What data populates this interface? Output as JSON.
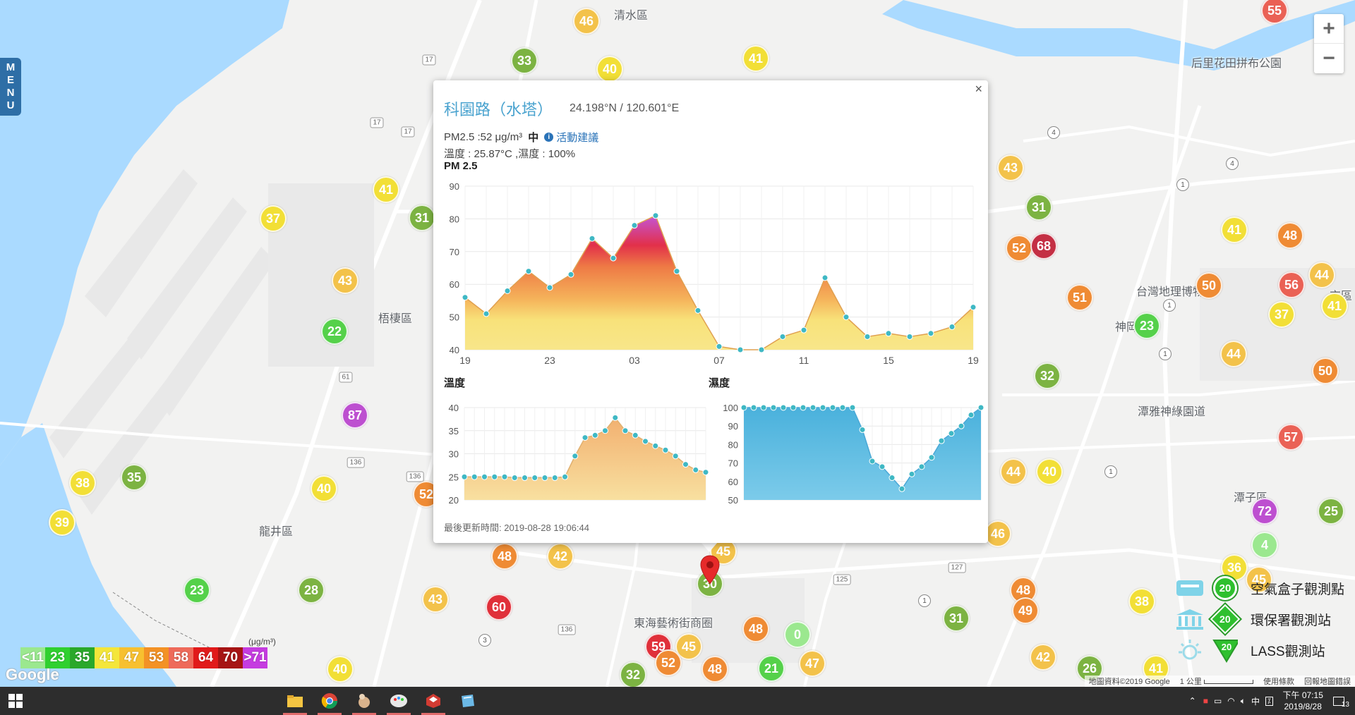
{
  "menu": {
    "label": "MENU"
  },
  "zoom": {
    "in_label": "+",
    "out_label": "−"
  },
  "map_labels": [
    {
      "text": "清水區",
      "x": 870,
      "y": 8
    },
    {
      "text": "后里花田拼布公園",
      "x": 1688,
      "y": 76
    },
    {
      "text": "梧棲區",
      "x": 536,
      "y": 438
    },
    {
      "text": "台灣地理博物館",
      "x": 1610,
      "y": 400
    },
    {
      "text": "神岡區",
      "x": 1580,
      "y": 450
    },
    {
      "text": "潭雅神綠園道",
      "x": 1612,
      "y": 570
    },
    {
      "text": "龍井區",
      "x": 367,
      "y": 740
    },
    {
      "text": "潭子區",
      "x": 1748,
      "y": 692
    },
    {
      "text": "東海藝術街商圈",
      "x": 898,
      "y": 870
    },
    {
      "text": "京區",
      "x": 1884,
      "y": 406
    }
  ],
  "markers": [
    {
      "v": "46",
      "x": 831,
      "y": 30
    },
    {
      "v": "33",
      "x": 743,
      "y": 86
    },
    {
      "v": "40",
      "x": 864,
      "y": 98
    },
    {
      "v": "41",
      "x": 1071,
      "y": 83
    },
    {
      "v": "55",
      "x": 1806,
      "y": 15
    },
    {
      "v": "41",
      "x": 547,
      "y": 269
    },
    {
      "v": "37",
      "x": 387,
      "y": 310
    },
    {
      "v": "31",
      "x": 598,
      "y": 309
    },
    {
      "v": "43",
      "x": 489,
      "y": 398
    },
    {
      "v": "22",
      "x": 474,
      "y": 470
    },
    {
      "v": "87",
      "x": 503,
      "y": 589
    },
    {
      "v": "38",
      "x": 117,
      "y": 685
    },
    {
      "v": "35",
      "x": 190,
      "y": 677
    },
    {
      "v": "39",
      "x": 88,
      "y": 741
    },
    {
      "v": "40",
      "x": 459,
      "y": 693
    },
    {
      "v": "52",
      "x": 604,
      "y": 701
    },
    {
      "v": "48",
      "x": 715,
      "y": 789
    },
    {
      "v": "42",
      "x": 794,
      "y": 789
    },
    {
      "v": "23",
      "x": 279,
      "y": 837
    },
    {
      "v": "28",
      "x": 441,
      "y": 837
    },
    {
      "v": "43",
      "x": 617,
      "y": 850
    },
    {
      "v": "60",
      "x": 707,
      "y": 861
    },
    {
      "v": "40",
      "x": 482,
      "y": 949
    },
    {
      "v": "59",
      "x": 933,
      "y": 917
    },
    {
      "v": "45",
      "x": 976,
      "y": 917
    },
    {
      "v": "52",
      "x": 947,
      "y": 940
    },
    {
      "v": "48",
      "x": 1013,
      "y": 949
    },
    {
      "v": "32",
      "x": 897,
      "y": 957
    },
    {
      "v": "48",
      "x": 1071,
      "y": 892
    },
    {
      "v": "0",
      "x": 1130,
      "y": 900
    },
    {
      "v": "21",
      "x": 1093,
      "y": 948
    },
    {
      "v": "47",
      "x": 1151,
      "y": 941
    },
    {
      "v": "30",
      "x": 1006,
      "y": 828
    },
    {
      "v": "45",
      "x": 1025,
      "y": 782
    },
    {
      "v": "43",
      "x": 1432,
      "y": 238
    },
    {
      "v": "31",
      "x": 1472,
      "y": 294
    },
    {
      "v": "52",
      "x": 1444,
      "y": 352
    },
    {
      "v": "68",
      "x": 1479,
      "y": 349
    },
    {
      "v": "51",
      "x": 1530,
      "y": 422
    },
    {
      "v": "23",
      "x": 1625,
      "y": 462
    },
    {
      "v": "32",
      "x": 1484,
      "y": 533
    },
    {
      "v": "41",
      "x": 1749,
      "y": 326
    },
    {
      "v": "48",
      "x": 1828,
      "y": 334
    },
    {
      "v": "50",
      "x": 1713,
      "y": 405
    },
    {
      "v": "56",
      "x": 1830,
      "y": 404
    },
    {
      "v": "44",
      "x": 1873,
      "y": 390
    },
    {
      "v": "41",
      "x": 1891,
      "y": 434
    },
    {
      "v": "37",
      "x": 1816,
      "y": 446
    },
    {
      "v": "44",
      "x": 1748,
      "y": 502
    },
    {
      "v": "50",
      "x": 1878,
      "y": 526
    },
    {
      "v": "44",
      "x": 1436,
      "y": 669
    },
    {
      "v": "40",
      "x": 1487,
      "y": 669
    },
    {
      "v": "46",
      "x": 1414,
      "y": 757
    },
    {
      "v": "57",
      "x": 1829,
      "y": 620
    },
    {
      "v": "72",
      "x": 1792,
      "y": 725
    },
    {
      "v": "25",
      "x": 1886,
      "y": 725
    },
    {
      "v": "4",
      "x": 1792,
      "y": 773
    },
    {
      "v": "36",
      "x": 1749,
      "y": 805
    },
    {
      "v": "45",
      "x": 1784,
      "y": 822
    },
    {
      "v": "48",
      "x": 1450,
      "y": 837
    },
    {
      "v": "49",
      "x": 1453,
      "y": 866
    },
    {
      "v": "38",
      "x": 1618,
      "y": 853
    },
    {
      "v": "31",
      "x": 1355,
      "y": 877
    },
    {
      "v": "42",
      "x": 1478,
      "y": 932
    },
    {
      "v": "26",
      "x": 1544,
      "y": 948
    },
    {
      "v": "41",
      "x": 1638,
      "y": 948
    }
  ],
  "legend": {
    "cells": [
      {
        "label": "<11",
        "color": "#9be88f"
      },
      {
        "label": "23",
        "color": "#2fd02f"
      },
      {
        "label": "35",
        "color": "#2aa82a"
      },
      {
        "label": "41",
        "color": "#f4e63a"
      },
      {
        "label": "47",
        "color": "#f7c030"
      },
      {
        "label": "53",
        "color": "#f39225"
      },
      {
        "label": "58",
        "color": "#ee6a5a"
      },
      {
        "label": "64",
        "color": "#e11a1a"
      },
      {
        "label": "70",
        "color": "#a61414"
      },
      {
        "label": ">71",
        "color": "#c53ce0"
      }
    ],
    "unit": "(μg/m³)"
  },
  "google_logo": "Google",
  "attribution": {
    "data": "地圖資料©2019 Google",
    "scale": "1 公里",
    "terms": "使用條款",
    "report": "回報地圖錯誤"
  },
  "station_legend": [
    {
      "value": "20",
      "label": "空氣盒子觀測點"
    },
    {
      "value": "20",
      "label": "環保署觀測站"
    },
    {
      "value": "20",
      "label": "LASS觀測站"
    }
  ],
  "popup": {
    "close": "×",
    "title": "科園路（水塔）",
    "coords": "24.198°N / 120.601°E",
    "pm_text": "PM2.5 :52 μg/m³",
    "pm_level": "中",
    "advice_icon": "i",
    "advice_label": "活動建議",
    "env_text": "溫度 : 25.87°C ,濕度 : 100%",
    "pm_chart_title": "PM 2.5",
    "temp_chart_title": "溫度",
    "humid_chart_title": "濕度",
    "updated": "最後更新時間: 2019-08-28 19:06:44"
  },
  "chart_data": [
    {
      "type": "area",
      "title": "PM 2.5",
      "x_tick_labels": [
        "19",
        "23",
        "03",
        "07",
        "11",
        "15",
        "19"
      ],
      "ylim": [
        40,
        90
      ],
      "y_ticks": [
        40,
        50,
        60,
        70,
        80,
        90
      ],
      "grid": true,
      "values": [
        56,
        51,
        58,
        64,
        59,
        63,
        74,
        68,
        78,
        81,
        64,
        52,
        41,
        40,
        40,
        44,
        46,
        62,
        50,
        44,
        45,
        44,
        45,
        47,
        53
      ]
    },
    {
      "type": "area",
      "title": "溫度",
      "ylim": [
        20,
        40
      ],
      "y_ticks": [
        20,
        25,
        30,
        35,
        40
      ],
      "grid": true,
      "values": [
        25,
        25,
        25,
        25,
        25,
        24.8,
        24.8,
        24.8,
        24.8,
        24.8,
        25,
        29.5,
        33.5,
        34,
        35,
        37.8,
        35,
        34,
        32.7,
        31.7,
        30.8,
        29.5,
        27.7,
        26.5,
        26
      ]
    },
    {
      "type": "area",
      "title": "濕度",
      "ylim": [
        50,
        100
      ],
      "y_ticks": [
        50,
        60,
        70,
        80,
        90,
        100
      ],
      "grid": true,
      "values": [
        100,
        100,
        100,
        100,
        100,
        100,
        100,
        100,
        100,
        100,
        100,
        100,
        88,
        71,
        68,
        62,
        56,
        64,
        68,
        73,
        82,
        86,
        90,
        96,
        100
      ]
    }
  ],
  "taskbar": {
    "apps": [
      "file-explorer",
      "chrome",
      "app-3",
      "app-4",
      "app-5",
      "app-6"
    ],
    "ime": "中",
    "time": "下午 07:15",
    "date": "2019/8/28",
    "notifications": "13"
  }
}
